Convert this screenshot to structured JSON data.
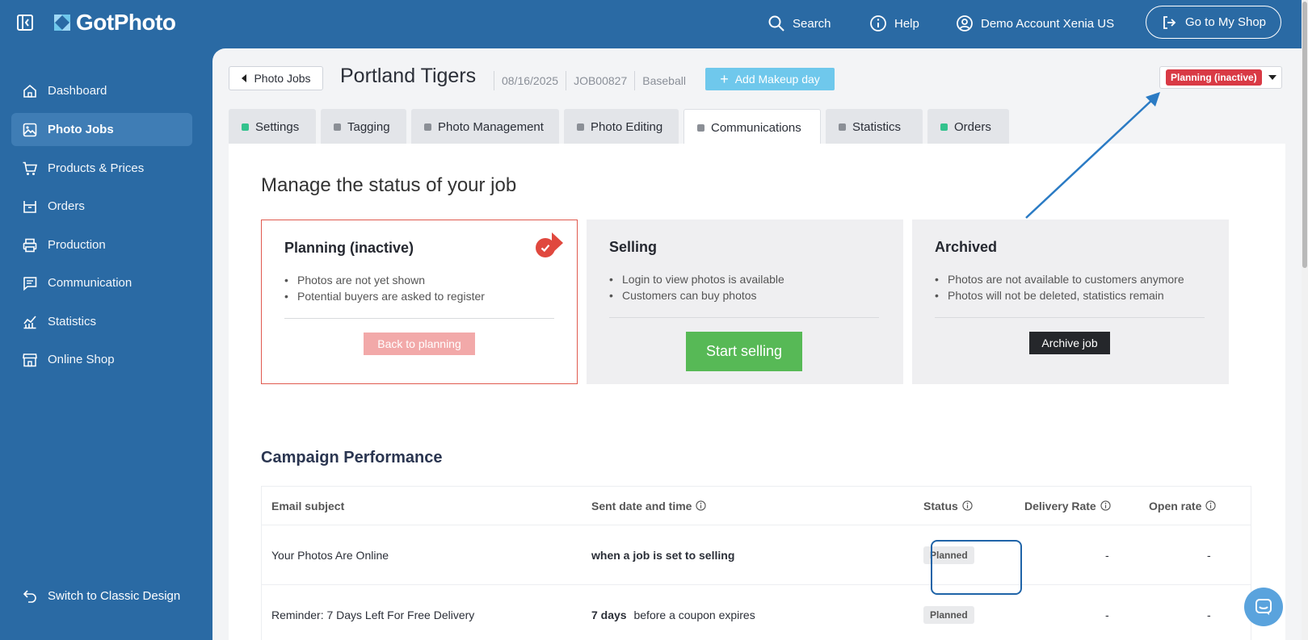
{
  "app": {
    "logo_text": "GotPhoto"
  },
  "topbar": {
    "search_label": "Search",
    "help_label": "Help",
    "account_label": "Demo Account Xenia US",
    "shop_button_label": "Go to My Shop"
  },
  "sidebar": {
    "items": [
      {
        "label": "Dashboard",
        "icon": "home-icon"
      },
      {
        "label": "Photo Jobs",
        "icon": "image-icon",
        "active": true
      },
      {
        "label": "Products & Prices",
        "icon": "cart-icon"
      },
      {
        "label": "Orders",
        "icon": "basket-icon"
      },
      {
        "label": "Production",
        "icon": "printer-icon"
      },
      {
        "label": "Communication",
        "icon": "message-icon"
      },
      {
        "label": "Statistics",
        "icon": "chart-icon"
      },
      {
        "label": "Online Shop",
        "icon": "store-icon"
      }
    ],
    "switch_label": "Switch to Classic Design"
  },
  "job": {
    "back_label": "Photo Jobs",
    "title": "Portland Tigers",
    "date": "08/16/2025",
    "job_id": "JOB00827",
    "sport": "Baseball",
    "add_makeup_label": "Add Makeup day",
    "status_label": "Planning (inactive)"
  },
  "tabs": [
    {
      "label": "Settings",
      "dot": "green"
    },
    {
      "label": "Tagging",
      "dot": "gray"
    },
    {
      "label": "Photo Management",
      "dot": "gray"
    },
    {
      "label": "Photo Editing",
      "dot": "gray"
    },
    {
      "label": "Communications",
      "dot": "gray",
      "active": true
    },
    {
      "label": "Statistics",
      "dot": "gray"
    },
    {
      "label": "Orders",
      "dot": "green"
    }
  ],
  "status_section": {
    "title": "Manage the status of your job",
    "stages": [
      {
        "title": "Planning (inactive)",
        "bullets": [
          "Photos are not yet shown",
          "Potential buyers are asked to register"
        ],
        "button": "Back to planning",
        "current": true
      },
      {
        "title": "Selling",
        "bullets": [
          "Login to view photos is available",
          "Customers can buy photos"
        ],
        "button": "Start selling"
      },
      {
        "title": "Archived",
        "bullets": [
          "Photos are not available to customers anymore",
          "Photos will not be deleted, statistics remain"
        ],
        "button": "Archive job"
      }
    ]
  },
  "campaign": {
    "title": "Campaign Performance",
    "columns": [
      "Email subject",
      "Sent date and time",
      "Status",
      "Delivery Rate",
      "Open rate"
    ],
    "rows": [
      {
        "subject": "Your Photos Are Online",
        "sent_bold": "when a job is set to selling",
        "sent_rest": "",
        "status": "Planned",
        "delivery": "-",
        "open": "-"
      },
      {
        "subject": "Reminder: 7 Days Left For Free Delivery",
        "sent_bold": "7 days",
        "sent_rest": " before a coupon expires",
        "status": "Planned",
        "delivery": "-",
        "open": "-"
      }
    ]
  },
  "colors": {
    "brand_blue": "#2a6aa4",
    "planning_red": "#d93a45",
    "selling_green": "#57b956",
    "makeup_blue": "#6fc8ec"
  }
}
